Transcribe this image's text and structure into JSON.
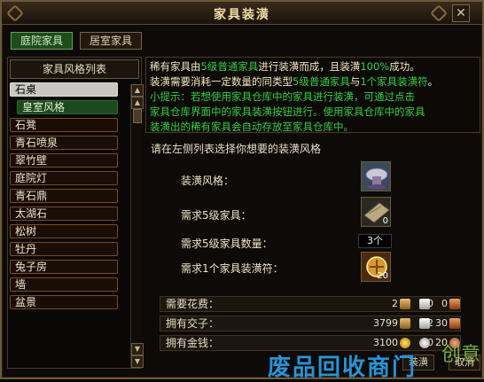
{
  "window": {
    "title": "家具装潢",
    "close_glyph": "✕"
  },
  "tabs": [
    {
      "label": "庭院家具",
      "active": true
    },
    {
      "label": "居室家具",
      "active": false
    }
  ],
  "list": {
    "header": "家具风格列表",
    "items": [
      {
        "label": "石桌",
        "state": "selected"
      },
      {
        "label": "皇室风格",
        "state": "sub"
      },
      {
        "label": "石凳",
        "state": "normal"
      },
      {
        "label": "青石喷泉",
        "state": "normal"
      },
      {
        "label": "翠竹壁",
        "state": "normal"
      },
      {
        "label": "庭院灯",
        "state": "normal"
      },
      {
        "label": "青石鼎",
        "state": "normal"
      },
      {
        "label": "太湖石",
        "state": "normal"
      },
      {
        "label": "松树",
        "state": "normal"
      },
      {
        "label": "牡丹",
        "state": "normal"
      },
      {
        "label": "兔子房",
        "state": "normal"
      },
      {
        "label": "墙",
        "state": "normal"
      },
      {
        "label": "盆景",
        "state": "normal"
      }
    ],
    "scroll_up": "▲",
    "scroll_down": "▼"
  },
  "info": {
    "line1": [
      {
        "t": "稀有家具由",
        "c": "cream"
      },
      {
        "t": "5级普通家具",
        "c": "green"
      },
      {
        "t": "进行装潢而成，且装潢",
        "c": "cream"
      },
      {
        "t": "100%",
        "c": "green"
      },
      {
        "t": "成功。",
        "c": "cream"
      }
    ],
    "line2": [
      {
        "t": "装潢需要消耗一定数量的同类型",
        "c": "cream"
      },
      {
        "t": "5级普通家具",
        "c": "green"
      },
      {
        "t": "与",
        "c": "cream"
      },
      {
        "t": "1个家具装潢符",
        "c": "green"
      },
      {
        "t": "。",
        "c": "cream"
      }
    ],
    "line3": "小提示：若想使用家具仓库中的家具进行装潢，可通过点击",
    "line4": "家具仓库界面中的家具装潢按钮进行。使用家具仓库中的家具",
    "line5": "装潢出的稀有家具会自动存放至家具仓库中。"
  },
  "prompt": "请在左侧列表选择你想要的装潢风格",
  "fields": {
    "style_label": "装潢风格：",
    "need_furniture_label": "需求5级家具：",
    "need_furniture_count_label": "需求5级家具数量：",
    "need_charm_label": "需求1个家具装潢符：",
    "need_furniture_slot_qty": "0",
    "need_furniture_count": "3个",
    "charm_slot_qty": "20"
  },
  "resources": {
    "cost": {
      "label": "需要花费：",
      "gold": "2",
      "silver": "0",
      "copper": "0"
    },
    "notes": {
      "label": "拥有交子：",
      "gold": "3799",
      "silver": "92",
      "copper": "30"
    },
    "coins": {
      "label": "拥有金钱：",
      "gold": "3100",
      "silver": "0",
      "copper": "20"
    }
  },
  "buttons": {
    "confirm": "装潢",
    "cancel": "取消"
  },
  "watermark": {
    "text": "废品回收商门",
    "logo": "创意"
  }
}
